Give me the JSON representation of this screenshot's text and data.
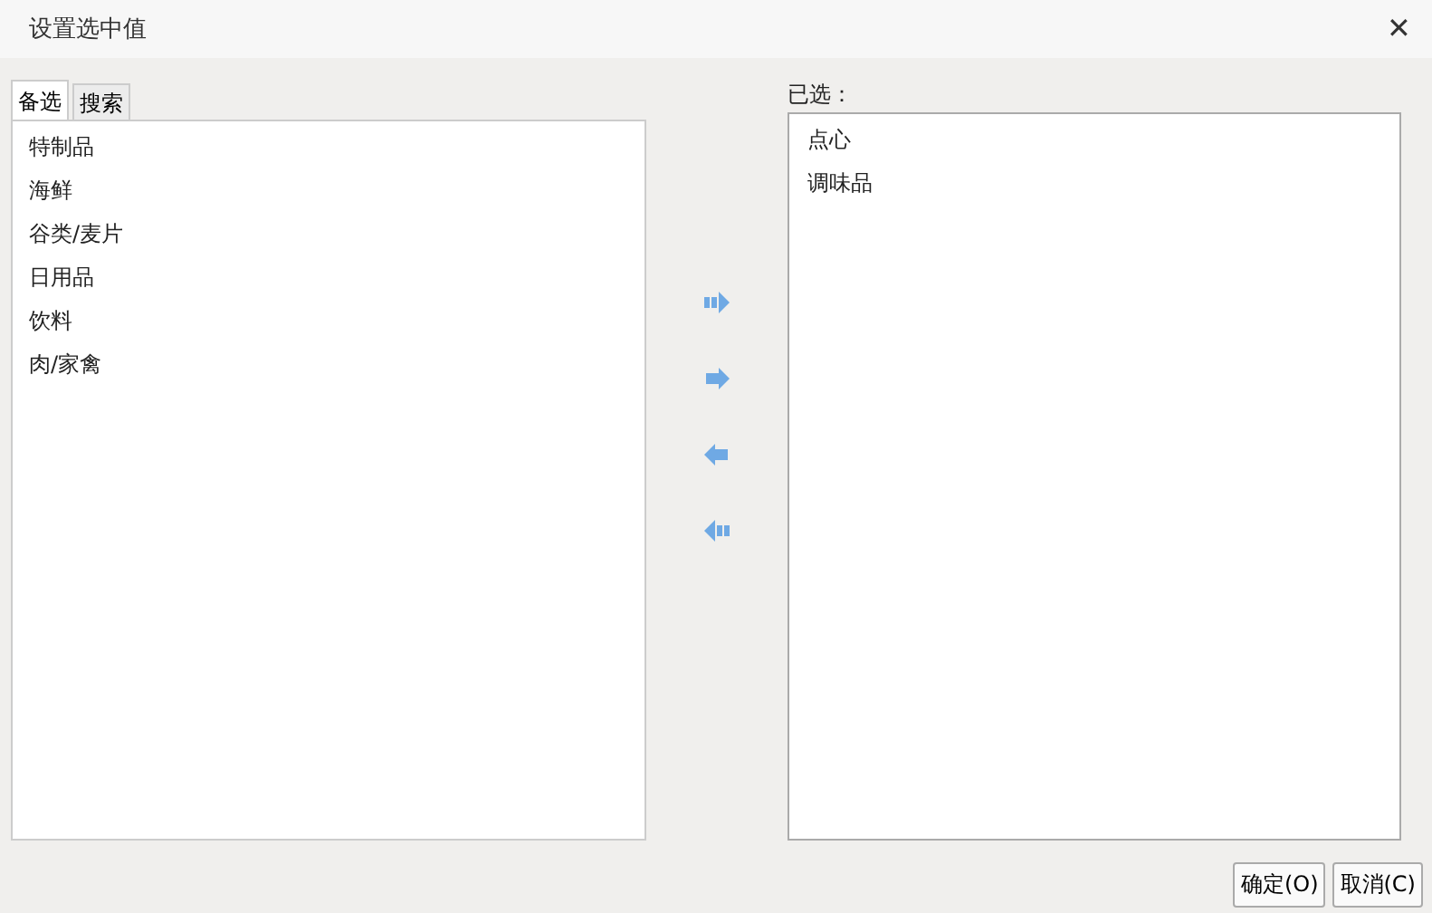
{
  "window": {
    "title": "设置选中值",
    "close": "✕"
  },
  "tabs": [
    {
      "label": "备选",
      "selected": true
    },
    {
      "label": "搜索",
      "selected": false
    }
  ],
  "available": {
    "items": [
      "特制品",
      "海鲜",
      "谷类/麦片",
      "日用品",
      "饮料",
      "肉/家禽"
    ]
  },
  "move_buttons": [
    {
      "kind": "add-all"
    },
    {
      "kind": "add"
    },
    {
      "kind": "remove"
    },
    {
      "kind": "remove-all"
    }
  ],
  "selected": {
    "label": "已选：",
    "items": [
      "点心",
      "调味品"
    ]
  },
  "buttons": [
    "确定(O)",
    "取消(C)"
  ]
}
